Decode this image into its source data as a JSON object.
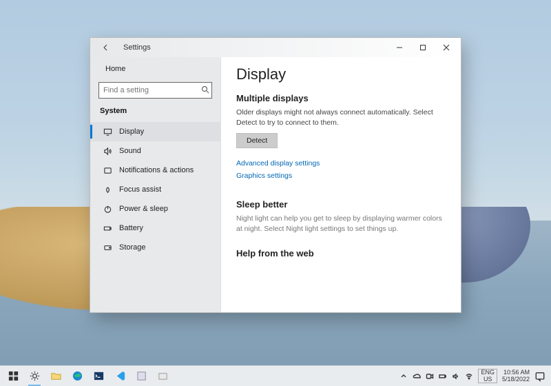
{
  "window": {
    "title": "Settings",
    "sidebar": {
      "home": "Home",
      "search_placeholder": "Find a setting",
      "category": "System",
      "items": [
        {
          "label": "Display"
        },
        {
          "label": "Sound"
        },
        {
          "label": "Notifications & actions"
        },
        {
          "label": "Focus assist"
        },
        {
          "label": "Power & sleep"
        },
        {
          "label": "Battery"
        },
        {
          "label": "Storage"
        }
      ]
    },
    "content": {
      "title": "Display",
      "multi": {
        "heading": "Multiple displays",
        "desc": "Older displays might not always connect automatically. Select Detect to try to connect to them.",
        "detect_label": "Detect",
        "link_advanced": "Advanced display settings",
        "link_graphics": "Graphics settings"
      },
      "sleep": {
        "heading": "Sleep better",
        "desc": "Night light can help you get to sleep by displaying warmer colors at night. Select Night light settings to set things up."
      },
      "help": {
        "heading": "Help from the web"
      }
    }
  },
  "taskbar": {
    "lang1": "ENG",
    "lang2": "US",
    "time": "10:56 AM",
    "date": "5/18/2022"
  }
}
